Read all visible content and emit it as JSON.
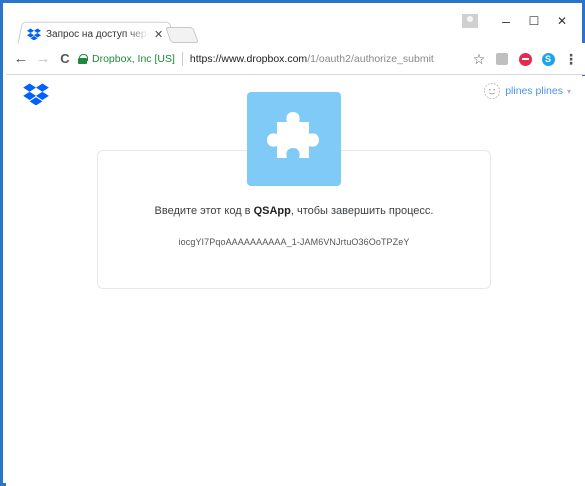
{
  "browser": {
    "tab": {
      "title": "Запрос на доступ через",
      "close": "✕"
    },
    "window_controls": {
      "minimize": "–",
      "maximize": "☐",
      "close": "✕"
    },
    "nav": {
      "back": "←",
      "forward": "→",
      "reload": "C"
    },
    "omnibox": {
      "site_identity": "Dropbox, Inc [US]",
      "url_host": "https://www.dropbox.com",
      "url_path": "/1/oauth2/authorize_submit"
    },
    "toolbar_icons": [
      "star-icon",
      "extension-icon",
      "lastpass-icon",
      "skype-icon",
      "menu-icon"
    ],
    "skype_letter": "S",
    "menu": "⋮",
    "star": "☆"
  },
  "page": {
    "user": {
      "name": "plines plines",
      "caret": "▾"
    },
    "prompt": {
      "before": "Введите этот код в ",
      "app": "QSApp",
      "after": ", чтобы завершить процесс."
    },
    "code": "iocgYI7PqoAAAAAAAAAA_1-JAM6VNJrtuO36OoTPZeY"
  },
  "colors": {
    "accent": "#2b74c8",
    "dropbox_blue": "#0061fe",
    "puzzle_tile": "#7fcaf6",
    "secure_green": "#1d8a3a",
    "link_blue": "#4a96e6"
  }
}
